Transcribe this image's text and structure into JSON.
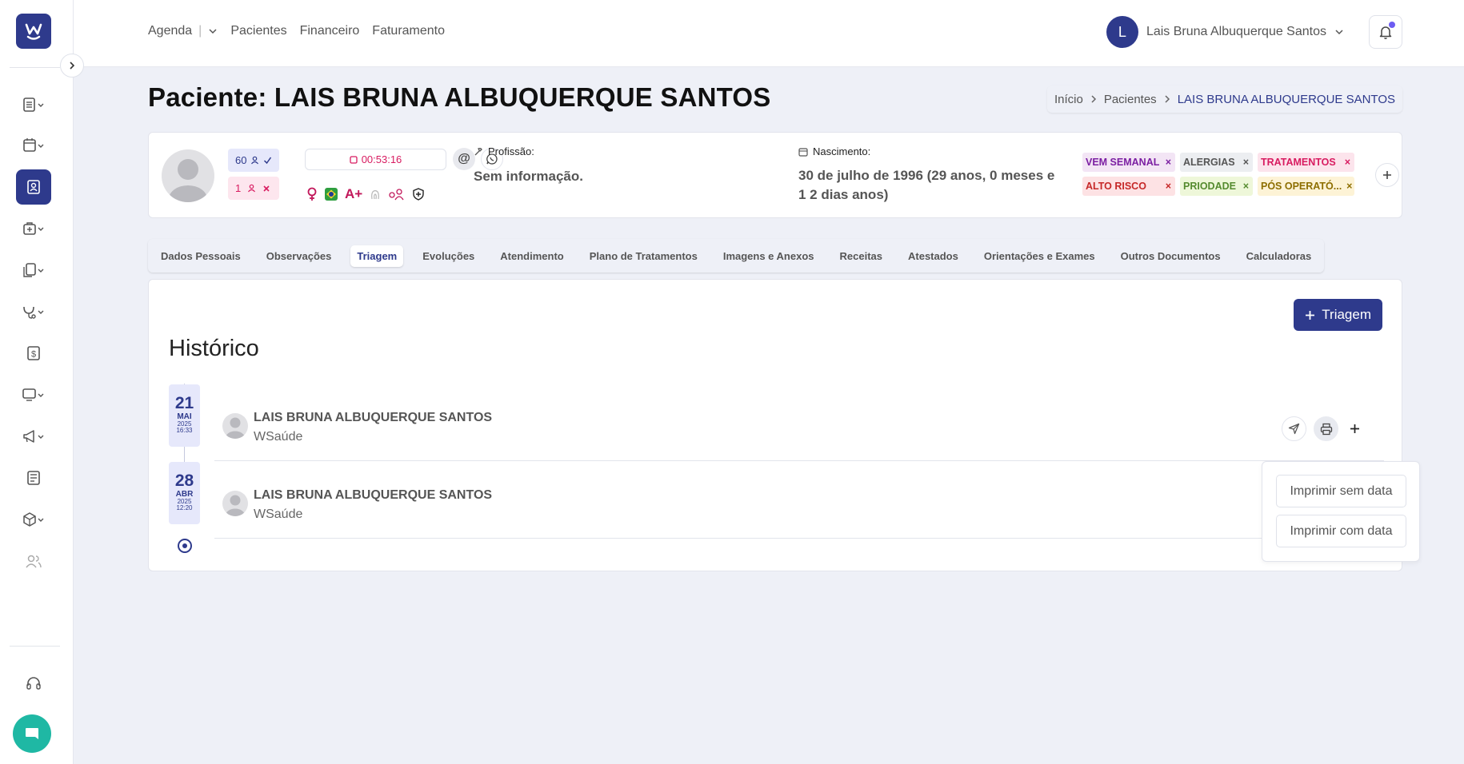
{
  "colors": {
    "primary": "#2e3a8c",
    "accent_pink": "#d81b60",
    "chat": "#1fb8a4",
    "background": "#eef0f7"
  },
  "topnav": {
    "items": [
      "Agenda",
      "Pacientes",
      "Financeiro",
      "Faturamento"
    ],
    "separator": "|"
  },
  "user": {
    "initial": "L",
    "name": "Lais Bruna Albuquerque Santos"
  },
  "page": {
    "title": "Paciente: LAIS BRUNA ALBUQUERQUE SANTOS"
  },
  "breadcrumb": {
    "items": [
      "Início",
      "Pacientes",
      "LAIS BRUNA ALBUQUERQUE SANTOS"
    ]
  },
  "patient": {
    "badge_attendances": "60",
    "badge_absences": "1",
    "timer": "00:53:16",
    "blood_type": "A+",
    "profissao_label": "Profissão:",
    "profissao_value": "Sem informação.",
    "nascimento_label": "Nascimento:",
    "nascimento_value": "30 de julho de 1996 (29 anos, 0 meses e 1 2 dias anos)"
  },
  "tags": [
    {
      "label": "VEM SEMANAL",
      "color": "#7b1fa2",
      "bg": "#f3e5f5"
    },
    {
      "label": "ALERGIAS",
      "color": "#555555",
      "bg": "#eceef1"
    },
    {
      "label": "TRATAMENTOS",
      "color": "#d81b60",
      "bg": "#fce4ec"
    },
    {
      "label": "ALTO RISCO",
      "color": "#c62828",
      "bg": "#fde2e4"
    },
    {
      "label": "PRIODADE",
      "color": "#558b2f",
      "bg": "#eef7d9"
    },
    {
      "label": "PÓS OPERATÓ...",
      "color": "#8d6e00",
      "bg": "#fdf3d6"
    }
  ],
  "tabs": [
    "Dados Pessoais",
    "Observações",
    "Triagem",
    "Evoluções",
    "Atendimento",
    "Plano de Tratamentos",
    "Imagens e Anexos",
    "Receitas",
    "Atestados",
    "Orientações e Exames",
    "Outros Documentos",
    "Calculadoras"
  ],
  "active_tab": "Triagem",
  "panel": {
    "add_button": "Triagem",
    "history_title": "Histórico"
  },
  "entries": [
    {
      "day": "21",
      "month": "MAI",
      "year": "2025",
      "time": "16:33",
      "name": "LAIS BRUNA ALBUQUERQUE SANTOS",
      "org": "WSaúde"
    },
    {
      "day": "28",
      "month": "ABR",
      "year": "2025",
      "time": "12:20",
      "name": "LAIS BRUNA ALBUQUERQUE SANTOS",
      "org": "WSaúde"
    }
  ],
  "print_menu": {
    "without_date": "Imprimir sem data",
    "with_date": "Imprimir com data"
  }
}
